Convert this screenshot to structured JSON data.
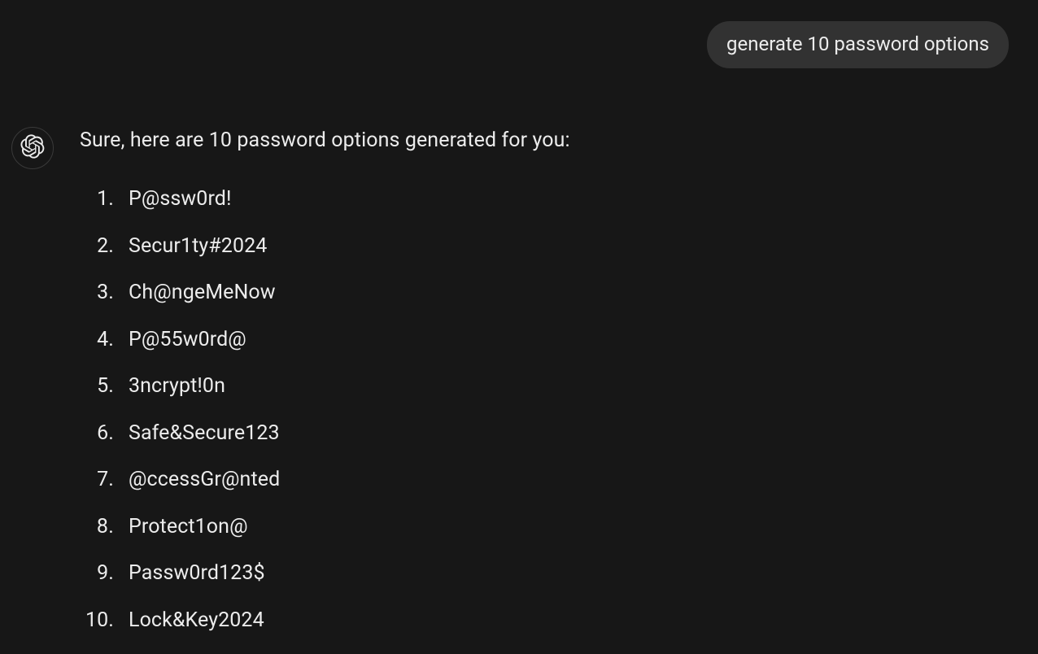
{
  "user": {
    "message": "generate 10 password options"
  },
  "assistant": {
    "intro": "Sure, here are 10 password options generated for you:",
    "passwords": [
      "P@ssw0rd!",
      "Secur1ty#2024",
      "Ch@ngeMeNow",
      "P@55w0rd@",
      "3ncrypt!0n",
      "Safe&Secure123",
      "@ccessGr@nted",
      "Protect1on@",
      "Passw0rd123$",
      "Lock&Key2024"
    ]
  }
}
